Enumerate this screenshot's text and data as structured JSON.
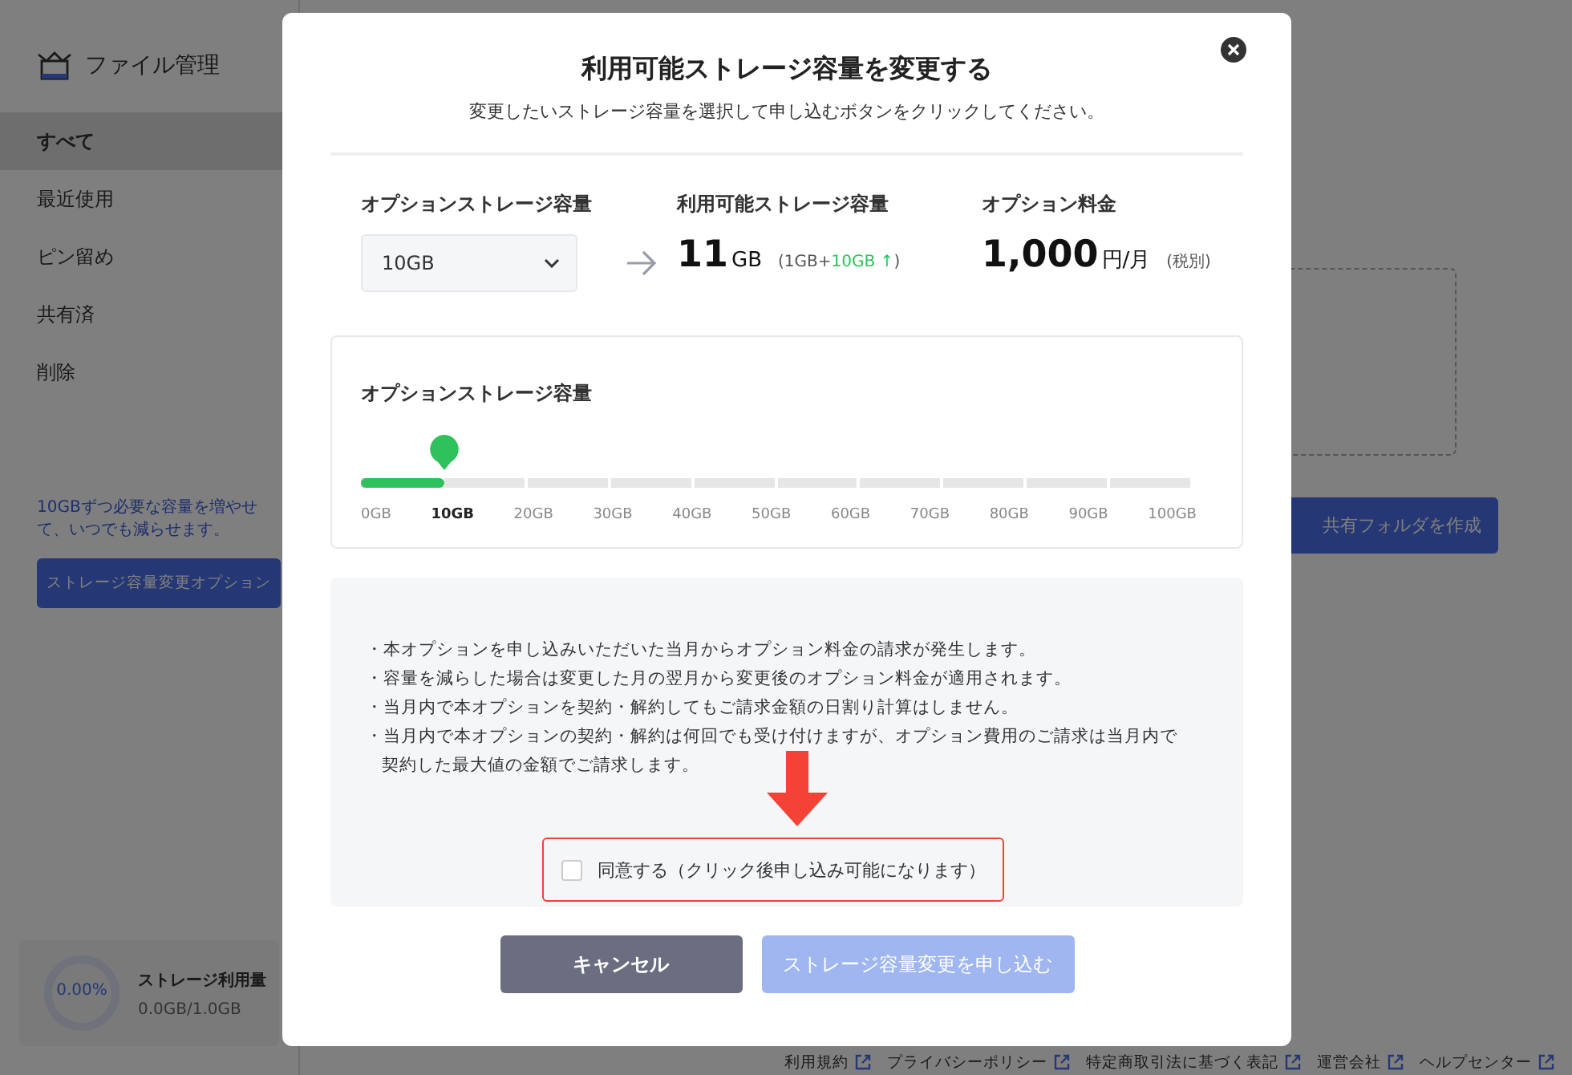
{
  "app": {
    "title": "ファイル管理"
  },
  "sidebar": {
    "items": [
      {
        "label": "すべて",
        "selected": true
      },
      {
        "label": "最近使用",
        "selected": false
      },
      {
        "label": "ピン留め",
        "selected": false
      },
      {
        "label": "共有済",
        "selected": false
      },
      {
        "label": "削除",
        "selected": false
      }
    ],
    "promo_text": "10GBずつ必要な容量を増やせて、いつでも減らせます。",
    "promo_button": "ストレージ容量変更オプション",
    "usage": {
      "percent": "0.00%",
      "level": 0,
      "title": "ストレージ利用量",
      "amount": "0.0GB/1.0GB"
    }
  },
  "main": {
    "create_shared_button": "共有フォルダを作成"
  },
  "footer_links": [
    "利用規約",
    "プライバシーポリシー",
    "特定商取引法に基づく表記",
    "運営会社",
    "ヘルプセンター"
  ],
  "modal": {
    "title": "利用可能ストレージ容量を変更する",
    "subtitle": "変更したいストレージ容量を選択して申し込むボタンをクリックしてください。",
    "option_label": "オプションストレージ容量",
    "option_value": "10GB",
    "available_label": "利用可能ストレージ容量",
    "available_value": "11",
    "available_unit": "GB",
    "breakdown_prefix": "(1GB+",
    "breakdown_added": "10GB ↑",
    "breakdown_suffix": ")",
    "fee_label": "オプション料金",
    "fee_value": "1,000",
    "fee_unit": "円/月",
    "fee_note": "(税別)",
    "slider": {
      "label": "オプションストレージ容量",
      "level": 0.1,
      "ticks": [
        {
          "label": "0GB",
          "selected": false
        },
        {
          "label": "10GB",
          "selected": true
        },
        {
          "label": "20GB",
          "selected": false
        },
        {
          "label": "30GB",
          "selected": false
        },
        {
          "label": "40GB",
          "selected": false
        },
        {
          "label": "50GB",
          "selected": false
        },
        {
          "label": "60GB",
          "selected": false
        },
        {
          "label": "70GB",
          "selected": false
        },
        {
          "label": "80GB",
          "selected": false
        },
        {
          "label": "90GB",
          "selected": false
        },
        {
          "label": "100GB",
          "selected": false
        }
      ]
    },
    "notes": [
      "・本オプションを申し込みいただいた当月からオプション料金の請求が発生します。",
      "・容量を減らした場合は変更した月の翌月から変更後のオプション料金が適用されます。",
      "・当月内で本オプションを契約・解約してもご請求金額の日割り計算はしません。",
      "・当月内で本オプションの契約・解約は何回でも受け付けますが、オプション費用のご請求は当月内で契約した最大値の金額でご請求します。"
    ],
    "agree": {
      "label": "同意する（クリック後申し込み可能になります）",
      "checked": false
    },
    "cancel_button": "キャンセル",
    "submit_button": {
      "label": "ストレージ容量変更を申し込む",
      "disabled": true
    }
  }
}
